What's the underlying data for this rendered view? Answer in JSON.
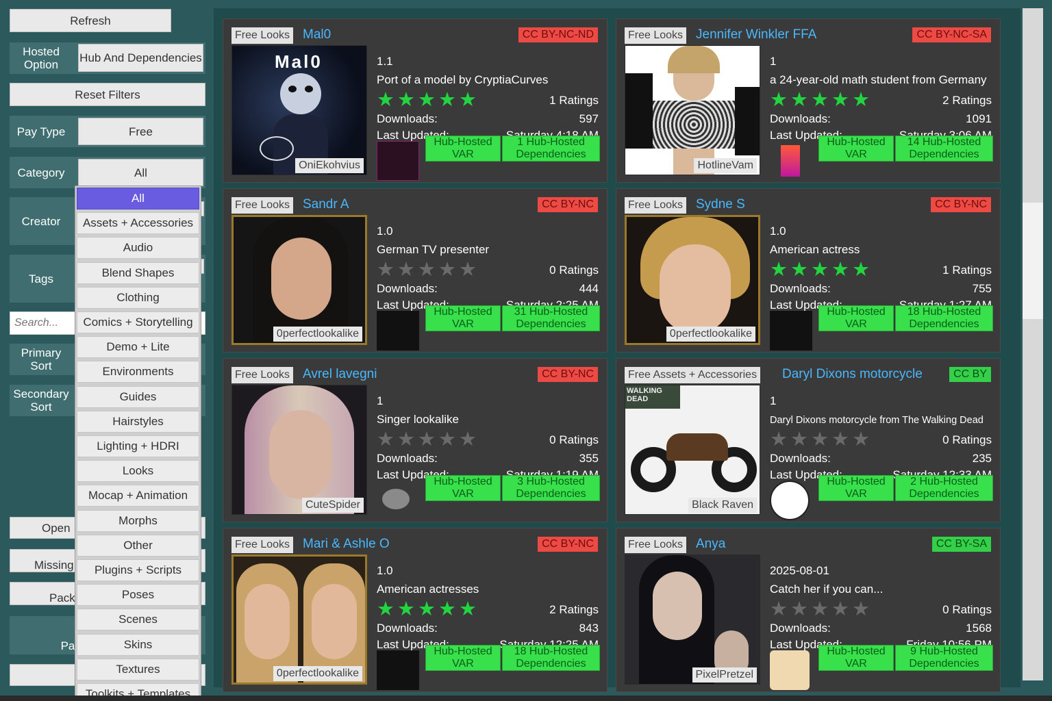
{
  "sidebar": {
    "refresh": "Refresh",
    "hosted_label": "Hosted Option",
    "hosted_value": "Hub And Dependencies",
    "reset": "Reset Filters",
    "pay_label": "Pay Type",
    "pay_value": "Free",
    "category_label": "Category",
    "category_value": "All",
    "creator_label": "Creator",
    "tags_label": "Tags",
    "search_placeholder": "Search...",
    "primary_sort_label": "Primary Sort",
    "secondary_sort_label": "Secondary Sort",
    "open_label": "Open",
    "missing_label": "Missing",
    "pack_label": "Pack",
    "pa_label": "Pa"
  },
  "category_options": [
    "All",
    "Assets + Accessories",
    "Audio",
    "Blend Shapes",
    "Clothing",
    "Comics + Storytelling",
    "Demo + Lite",
    "Environments",
    "Guides",
    "Hairstyles",
    "Lighting + HDRI",
    "Looks",
    "Mocap + Animation",
    "Morphs",
    "Other",
    "Plugins + Scripts",
    "Poses",
    "Scenes",
    "Skins",
    "Textures",
    "Toolkits + Templates"
  ],
  "colors": {
    "accent_green": "#38e04c",
    "license_red": "#ee4a45",
    "title_blue": "#48b8ff",
    "selected_purple": "#6a5ce0"
  },
  "cards": [
    {
      "type": "Free Looks",
      "title": "Mal0",
      "license": "CC BY-NC-ND",
      "license_color": "red",
      "version": "1.1",
      "desc": "Port of a model by CryptiaCurves",
      "stars": 5,
      "ratings": "1 Ratings",
      "downloads_label": "Downloads:",
      "downloads": "597",
      "updated_label": "Last Updated:",
      "updated": "Saturday 4:18 AM",
      "creator": "OniEkohvius",
      "thumb_text": "Mal0",
      "var_label": "Hub-Hosted VAR",
      "deps_label": "1 Hub-Hosted Dependencies"
    },
    {
      "type": "Free Looks",
      "title": "Jennifer Winkler FFA",
      "license": "CC BY-NC-SA",
      "license_color": "red",
      "version": "1",
      "desc": "a 24-year-old math student from Germany",
      "stars": 5,
      "ratings": "2 Ratings",
      "downloads_label": "Downloads:",
      "downloads": "1091",
      "updated_label": "Last Updated:",
      "updated": "Saturday 3:06 AM",
      "creator": "HotlineVam",
      "thumb_text": "",
      "var_label": "Hub-Hosted VAR",
      "deps_label": "14 Hub-Hosted Dependencies"
    },
    {
      "type": "Free Looks",
      "title": "Sandr A",
      "license": "CC BY-NC",
      "license_color": "red",
      "version": "1.0",
      "desc": "German TV presenter",
      "stars": 0,
      "ratings": "0 Ratings",
      "downloads_label": "Downloads:",
      "downloads": "444",
      "updated_label": "Last Updated:",
      "updated": "Saturday 2:25 AM",
      "creator": "0perfectlookalike",
      "thumb_text": "",
      "var_label": "Hub-Hosted VAR",
      "deps_label": "31 Hub-Hosted Dependencies"
    },
    {
      "type": "Free Looks",
      "title": "Sydne S",
      "license": "CC BY-NC",
      "license_color": "red",
      "version": "1.0",
      "desc": "American actress",
      "stars": 5,
      "ratings": "1 Ratings",
      "downloads_label": "Downloads:",
      "downloads": "755",
      "updated_label": "Last Updated:",
      "updated": "Saturday 1:27 AM",
      "creator": "0perfectlookalike",
      "thumb_text": "",
      "var_label": "Hub-Hosted VAR",
      "deps_label": "18 Hub-Hosted Dependencies"
    },
    {
      "type": "Free Looks",
      "title": "Avrel lavegni",
      "license": "CC BY-NC",
      "license_color": "red",
      "version": "1",
      "desc": "Singer lookalike",
      "stars": 0,
      "ratings": "0 Ratings",
      "downloads_label": "Downloads:",
      "downloads": "355",
      "updated_label": "Last Updated:",
      "updated": "Saturday 1:19 AM",
      "creator": "CuteSpider",
      "thumb_text": "",
      "var_label": "Hub-Hosted VAR",
      "deps_label": "3 Hub-Hosted Dependencies"
    },
    {
      "type": "Free Assets + Accessories",
      "title": "Daryl Dixons motorcycle",
      "license": "CC BY",
      "license_color": "green",
      "version": "1",
      "desc": "Daryl Dixons motorcycle from The Walking Dead",
      "stars": 0,
      "ratings": "0 Ratings",
      "downloads_label": "Downloads:",
      "downloads": "235",
      "updated_label": "Last Updated:",
      "updated": "Saturday 12:33 AM",
      "creator": "Black Raven",
      "thumb_text": "WALKING DEAD",
      "var_label": "Hub-Hosted VAR",
      "deps_label": "2 Hub-Hosted Dependencies"
    },
    {
      "type": "Free Looks",
      "title": "Mari & Ashle O",
      "license": "CC BY-NC",
      "license_color": "red",
      "version": "1.0",
      "desc": "American actresses",
      "stars": 5,
      "ratings": "2 Ratings",
      "downloads_label": "Downloads:",
      "downloads": "843",
      "updated_label": "Last Updated:",
      "updated": "Saturday 12:25 AM",
      "creator": "0perfectlookalike",
      "thumb_text": "",
      "var_label": "Hub-Hosted VAR",
      "deps_label": "18 Hub-Hosted Dependencies"
    },
    {
      "type": "Free Looks",
      "title": "Anya",
      "license": "CC BY-SA",
      "license_color": "green",
      "version": "2025-08-01",
      "desc": "Catch her if you can...",
      "stars": 0,
      "ratings": "0 Ratings",
      "downloads_label": "Downloads:",
      "downloads": "1568",
      "updated_label": "Last Updated:",
      "updated": "Friday 10:56 PM",
      "creator": "PixelPretzel",
      "thumb_text": "",
      "var_label": "Hub-Hosted VAR",
      "deps_label": "9 Hub-Hosted Dependencies"
    }
  ]
}
